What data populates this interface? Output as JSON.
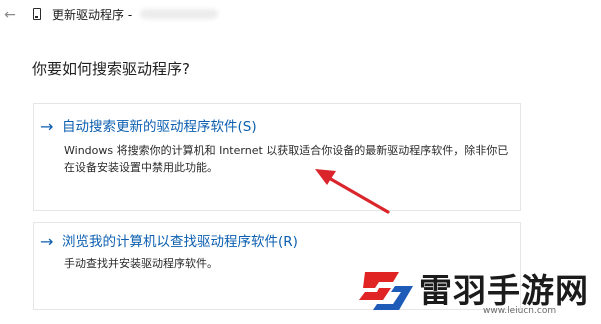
{
  "window": {
    "back_icon": "arrow-left-icon",
    "app_icon": "device-icon",
    "title": "更新驱动程序 -"
  },
  "heading": "你要如何搜索驱动程序?",
  "options": [
    {
      "arrow": "→",
      "title": "自动搜索更新的驱动程序软件(S)",
      "description": "Windows 将搜索你的计算机和 Internet 以获取适合你设备的最新驱动程序软件，除非你已在设备安装设置中禁用此功能。"
    },
    {
      "arrow": "→",
      "title": "浏览我的计算机以查找驱动程序软件(R)",
      "description": "手动查找并安装驱动程序软件。"
    }
  ],
  "watermark": {
    "brand": "雷羽手游网",
    "url": "www.leiucn.com"
  },
  "colors": {
    "link_blue": "#0c5fb0",
    "annotation_red": "#d9252b",
    "logo_red": "#e02424",
    "logo_blue": "#1e5bb8"
  }
}
